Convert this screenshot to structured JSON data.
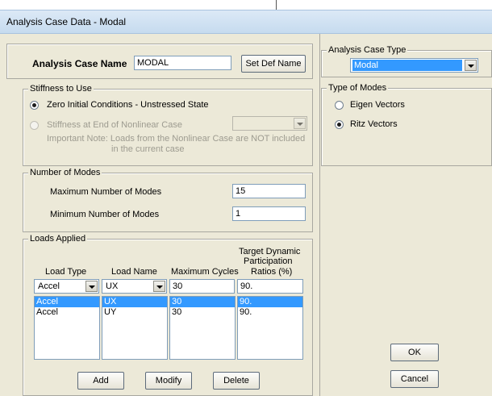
{
  "window": {
    "title": "Analysis Case Data - Modal"
  },
  "name_section": {
    "label": "Analysis Case Name",
    "value": "MODAL",
    "set_def_button": "Set Def Name"
  },
  "stiffness": {
    "legend": "Stiffness to Use",
    "option_zero": "Zero Initial Conditions - Unstressed State",
    "option_nonlinear": "Stiffness at End of Nonlinear Case",
    "nonlinear_case_value": "",
    "note_line1": "Important Note:  Loads from the Nonlinear Case are NOT included",
    "note_line2": "in the current case"
  },
  "modes": {
    "legend": "Number of Modes",
    "max_label": "Maximum Number of Modes",
    "max_value": "15",
    "min_label": "Minimum Number of Modes",
    "min_value": "1"
  },
  "loads": {
    "legend": "Loads Applied",
    "headers": {
      "load_type": "Load Type",
      "load_name": "Load Name",
      "max_cycles": "Maximum Cycles",
      "target_line1": "Target Dynamic",
      "target_line2": "Participation",
      "target_line3": "Ratios (%)"
    },
    "editor": {
      "load_type": "Accel",
      "load_name": "UX",
      "max_cycles": "30",
      "target": "90."
    },
    "rows": [
      {
        "load_type": "Accel",
        "load_name": "UX",
        "max_cycles": "30",
        "target": "90."
      },
      {
        "load_type": "Accel",
        "load_name": "UY",
        "max_cycles": "30",
        "target": "90."
      }
    ],
    "buttons": {
      "add": "Add",
      "modify": "Modify",
      "delete": "Delete"
    }
  },
  "case_type": {
    "legend": "Analysis Case Type",
    "value": "Modal"
  },
  "mode_type": {
    "legend": "Type of Modes",
    "option_eigen": "Eigen Vectors",
    "option_ritz": "Ritz Vectors",
    "selected": "Ritz Vectors"
  },
  "dialog_buttons": {
    "ok": "OK",
    "cancel": "Cancel"
  },
  "colors": {
    "selection": "#3399ff",
    "dialog_bg": "#ece9d8",
    "titlebar": "#c6dbef"
  }
}
